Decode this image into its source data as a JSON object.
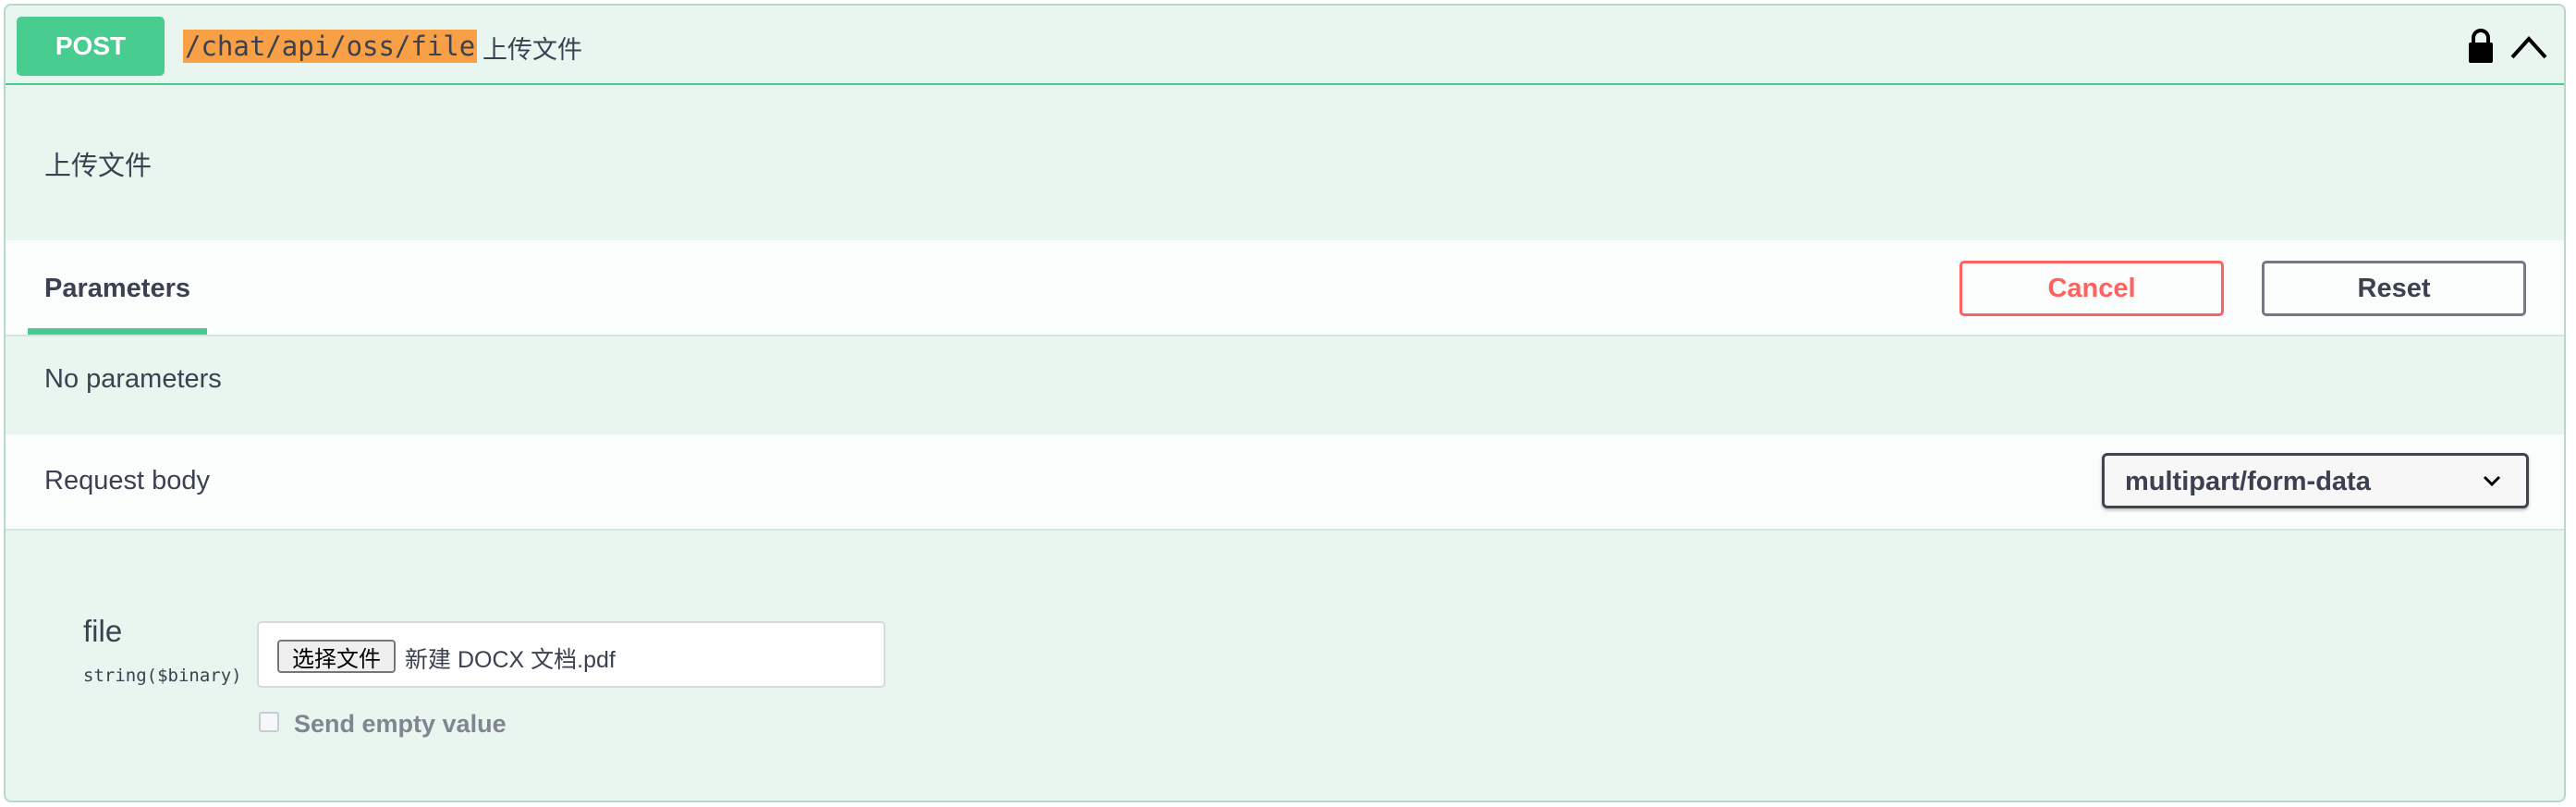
{
  "operation": {
    "method": "POST",
    "path": "/chat/api/oss/file",
    "summary": "上传文件",
    "description": "上传文件"
  },
  "icons": {
    "lock": "lock-icon",
    "collapse": "chevron-up-icon",
    "select_arrow": "chevron-down-icon"
  },
  "parameters": {
    "tab_label": "Parameters",
    "cancel_label": "Cancel",
    "reset_label": "Reset",
    "empty_text": "No parameters"
  },
  "request_body": {
    "title": "Request body",
    "content_type": "multipart/form-data",
    "fields": [
      {
        "name": "file",
        "type": "string($binary)",
        "choose_label": "选择文件",
        "file_name": "新建 DOCX 文档.pdf",
        "send_empty_label": "Send empty value"
      }
    ]
  },
  "colors": {
    "post": "#49cc90",
    "post_bg": "#e8f6ef",
    "path_highlight": "#f7a046",
    "cancel": "#ff6060"
  }
}
